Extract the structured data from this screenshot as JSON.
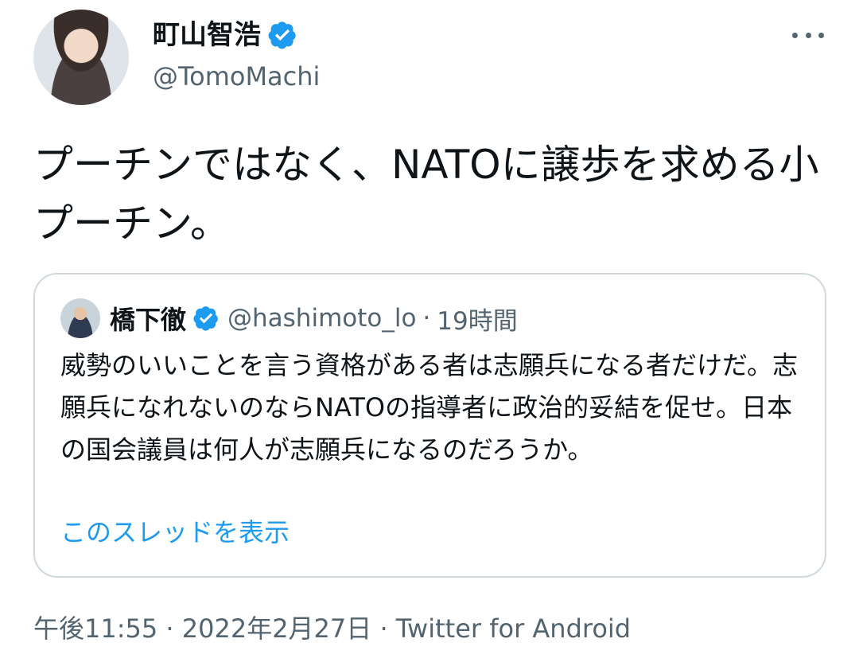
{
  "author": {
    "name": "町山智浩",
    "handle": "@TomoMachi"
  },
  "tweet": {
    "text": "プーチンではなく、NATOに譲歩を求める小プーチン。"
  },
  "quoted": {
    "name": "橋下徹",
    "handle": "@hashimoto_lo",
    "separator": "·",
    "time": "19時間",
    "text": "威勢のいいことを言う資格がある者は志願兵になる者だけだ。志願兵になれないのならNATOの指導者に政治的妥結を促せ。日本の国会議員は何人が志願兵になるのだろうか。",
    "show_thread": "このスレッドを表示"
  },
  "meta": {
    "time": "午後11:55",
    "dot1": "·",
    "date": "2022年2月27日",
    "dot2": "·",
    "source": "Twitter for Android"
  },
  "colors": {
    "verified": "#1d9bf0",
    "link": "#1d9bf0",
    "secondary_text": "#536471"
  },
  "icons": {
    "verified": "verified-badge-icon",
    "more": "more-options-icon"
  }
}
